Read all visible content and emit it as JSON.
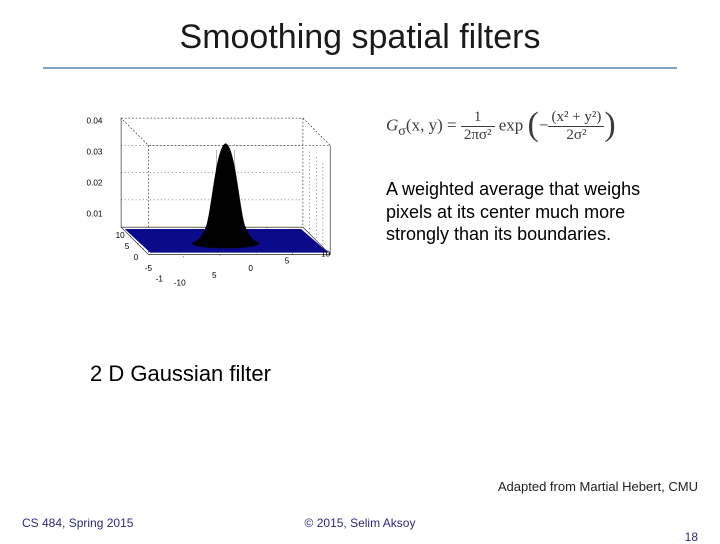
{
  "title": "Smoothing spatial filters",
  "formula": {
    "lhs": "G",
    "sub": "σ",
    "args": "(x, y)",
    "eq": " = ",
    "frac1_num": "1",
    "frac1_den": "2πσ²",
    "exp": " exp",
    "lparen": "(",
    "neg": "−",
    "frac2_num": "(x² + y²)",
    "frac2_den": "2σ²",
    "rparen": ")"
  },
  "description": "A weighted average that weighs pixels at its center much more strongly than its boundaries.",
  "caption": "2 D Gaussian filter",
  "attribution": "Adapted from Martial Hebert, CMU",
  "footer": {
    "left": "CS 484, Spring 2015",
    "center": "© 2015, Selim Aksoy",
    "right": "18"
  },
  "plot": {
    "y_ticks": [
      "0.04",
      "0.03",
      "0.02",
      "0.01"
    ],
    "x1_ticks": [
      "10",
      "5",
      "0",
      "-5",
      "-1"
    ],
    "x2_ticks": [
      "-10",
      "5",
      "0",
      "5",
      "10"
    ]
  }
}
